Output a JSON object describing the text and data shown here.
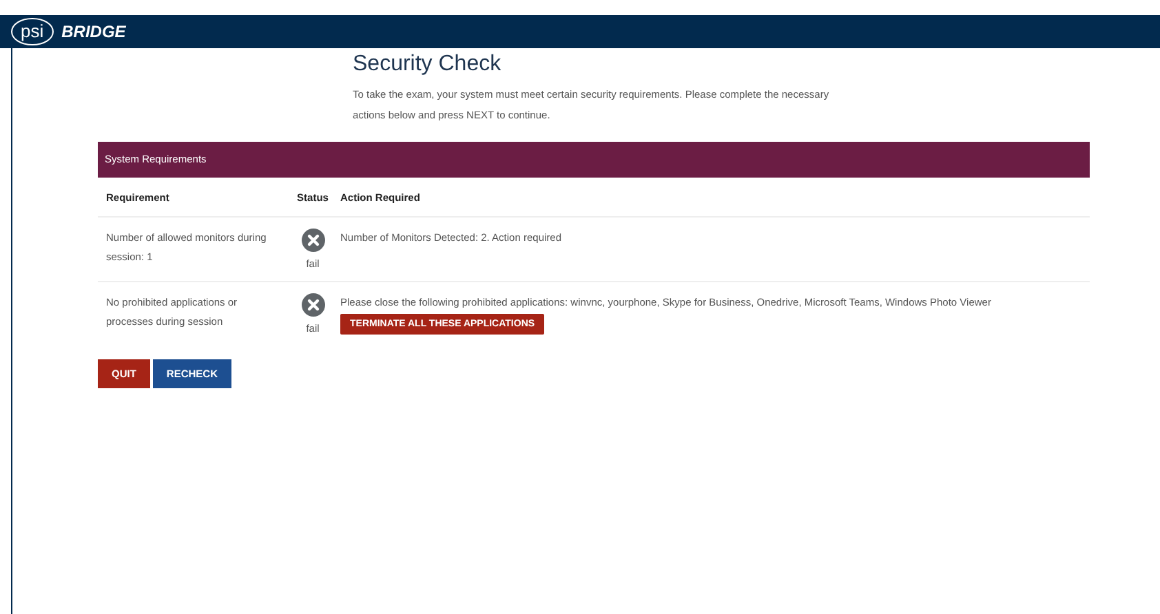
{
  "header": {
    "logo_text": "psi",
    "brand": "BRIDGE"
  },
  "title": "Security Check",
  "intro": "To take the exam, your system must meet certain security requirements. Please complete the necessary actions below and press NEXT to continue.",
  "panel": {
    "title": "System Requirements",
    "columns": [
      "Requirement",
      "Status",
      "Action Required"
    ],
    "rows": [
      {
        "requirement": "Number of allowed monitors during session: 1",
        "status": "fail",
        "action": "Number of Monitors Detected: 2. Action required"
      },
      {
        "requirement": "No prohibited applications or processes during session",
        "status": "fail",
        "action": "Please close the following prohibited applications: winvnc, yourphone, Skype for Business, Onedrive, Microsoft Teams, Windows Photo Viewer",
        "button": "TERMINATE ALL THESE APPLICATIONS"
      }
    ]
  },
  "buttons": [
    {
      "label": "QUIT",
      "kind": "danger"
    },
    {
      "label": "RECHECK",
      "kind": "primary"
    }
  ]
}
